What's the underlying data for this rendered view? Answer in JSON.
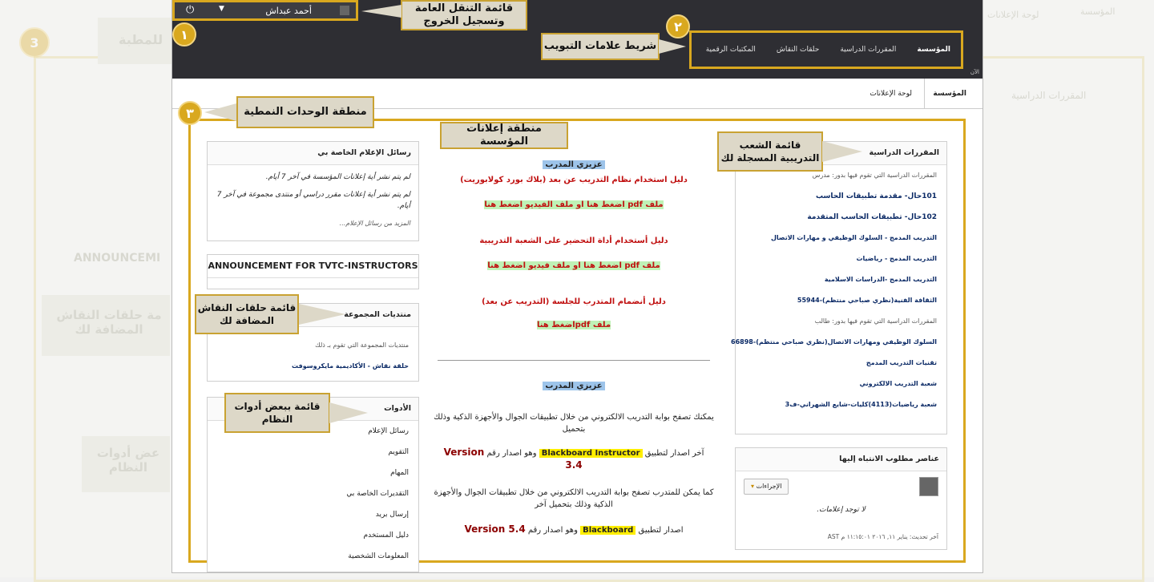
{
  "background": {
    "top_tab_1": "المؤسسة",
    "top_tab_2": "لوحة الإعلانات",
    "heading_right": "المقررات الدراسية",
    "left_big_1": "للمطبة",
    "left_big_2": "مة حلقات النقاش المضافة لك",
    "left_big_3": "عض أدوات النظام",
    "announce": "ANNOUNCEMI",
    "badge3": "3"
  },
  "topbar": {
    "user_name": "أحمد عبداش",
    "tabs": [
      "المؤسسة",
      "المقررات الدراسية",
      "حلقات النقاش",
      "المكتبات الرقمية"
    ],
    "corner_label": "الآن"
  },
  "callouts": {
    "logout": "قائمة التنقل العامة وتسجيل الخروج",
    "tabs": "شريط علامات التبويب",
    "modules": "منطقة الوحدات النمطية",
    "announcements": "منطقة إعلانات المؤسسة",
    "courses": "قائمة الشعب التدريبية المسجلة لك",
    "discussions": "قائمة حلقات النقاش المضافة لك",
    "tools": "قائمة ببعض أدوات النظام",
    "n1": "١",
    "n2": "٢",
    "n3": "٣"
  },
  "page_tabs": [
    "المؤسسة",
    "لوحة الإعلانات"
  ],
  "courses_module": {
    "title": "المقررات الدراسية",
    "items": [
      "المقررات الدراسية التي تقوم فيها بدور: مدرس",
      "101حال- مقدمة تطبيقات الحاسب",
      "102حال- تطبيقات الحاسب المتقدمة",
      "التدريب المدمج - السلوك الوظيفي و مهارات الاتصال",
      "التدريب المدمج - رياضيات",
      "التدريب المدمج -الدراسات الاسلامية",
      "الثقافة الفنية(نظري صباحي منتظم)-55944",
      "المقررات الدراسية التي تقوم فيها بدور: طالب",
      "السلوك الوظيفي ومهارات الاتصال(نظري صباحي منتظم)-66898",
      "تقنيات التدريب المدمج",
      "شعبة التدريب الالكتروني",
      "شعبة رياضيات(4113)كليات-شايع الشهراني-ف3"
    ]
  },
  "attention_module": {
    "title": "عناصر مطلوب الانتباه إليها",
    "actions": "الإجراءات",
    "empty": "لا توجد إعلامات.",
    "updated": "آخر تحديث: يناير ١١, ٢٠١٦ ١١:١٥:٠١ م AST"
  },
  "messages_module": {
    "title": "رسائل الإعلام الخاصة بي",
    "line1": "لم يتم نشر أية إعلانات المؤسسة في آخر 7 أيام.",
    "line2": "لم يتم نشر أية إعلانات مقرر دراسي أو منتدى مجموعة في آخر 7 أيام.",
    "more": "المزيد من رسائل الإعلام..."
  },
  "announcement_box": {
    "title": "ANNOUNCEMENT FOR TVTC-INSTRUCTORS"
  },
  "groups_module": {
    "title": "منتديات المجموعة",
    "desc": "منتديات المجموعة التي تقوم بـ ذلك",
    "link": "حلقة نقاش - الأكاديمية مايكروسوفت"
  },
  "tools_module": {
    "title": "الأدوات",
    "items": [
      "رسائل الإعلام",
      "التقويم",
      "المهام",
      "التقديرات الخاصة بي",
      "إرسال بريد",
      "دليل المستخدم",
      "المعلومات الشخصية"
    ]
  },
  "center": {
    "dear1": "عزيزي المدرب",
    "guide1": "دليل استخدام نظام التدريب عن بعد (بلاك بورد كولابوريت)",
    "guide1_links": "ملف pdf اضغط هنا  او ملف الفيديو اضغط هنا",
    "guide2": "دليل أستخدام أداة التحضير على الشعبة التدريبية",
    "guide2_links": "ملف pdf اضغط هنا  او ملف فيديو اضغط هنا",
    "guide3": "دليل أنضمام المتدرب للجلسة (التدريب عن بعد)",
    "guide3_links": "ملف pdfاضغط هنا",
    "dear2": "عزيزي المدرب",
    "p1": "يمكنك تصفح بوابة التدريب الالكتروني من خلال تطبيقات الجوال والأجهزة الذكية وذلك بتحميل",
    "p2a": "آخر اصدار لتطبيق",
    "p2b": "Blackboard Instructor",
    "p2c": "وهو اصدار رقم",
    "p2d": "Version 3.4",
    "p3": "كما يمكن للمتدرب تصفح بوابة التدريب الالكتروني من خلال تطبيقات الجوال والأجهزة الذكية وذلك بتحميل آخر",
    "p4a": "اصدار لتطبيق",
    "p4b": "Blackboard",
    "p4c": "وهو اصدار رقم",
    "p4d": "Version 5.4"
  }
}
